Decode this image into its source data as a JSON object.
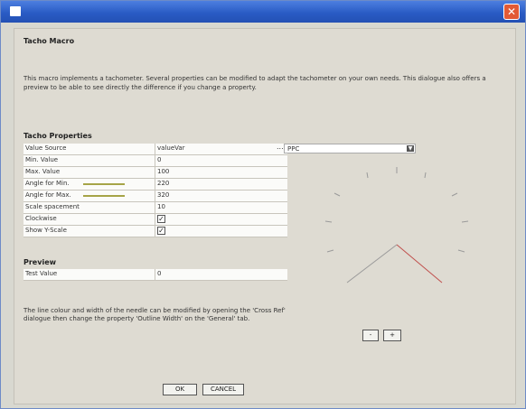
{
  "window": {
    "close_glyph": "✕"
  },
  "header": {
    "title": "Tacho Macro"
  },
  "description": "This macro implements a tachometer. Several properties can be modified to adapt the tachometer on your own needs. This dialogue also offers a preview to be able to see directly the difference if you change a property.",
  "properties": {
    "title": "Tacho Properties",
    "rows": [
      {
        "label": "Value Source",
        "value": "valueVar"
      },
      {
        "label": "Min. Value",
        "value": "0"
      },
      {
        "label": "Max. Value",
        "value": "100"
      },
      {
        "label": "Angle for Min.",
        "value": "220"
      },
      {
        "label": "Angle for Max.",
        "value": "320"
      },
      {
        "label": "Scale spacement",
        "value": "10"
      },
      {
        "label": "Clockwise",
        "checked": true
      },
      {
        "label": "Show Y-Scale",
        "checked": true
      }
    ],
    "source_button": "...",
    "source_select": "PPC"
  },
  "preview": {
    "title": "Preview",
    "test_label": "Test Value",
    "test_value": "0"
  },
  "note": "The line colour and width of the needle can be modified by opening the 'Cross Ref' dialogue then change the property 'Outline Width' on the 'General' tab.",
  "zoom": {
    "minus": "-",
    "plus": "+"
  },
  "buttons": {
    "ok": "OK",
    "cancel": "CANCEL"
  },
  "colors": {
    "titlebar": "#2a5cc5",
    "needle_left": "#9a9a9a",
    "needle_right": "#c0504d",
    "angle_line": "#a6a447"
  }
}
